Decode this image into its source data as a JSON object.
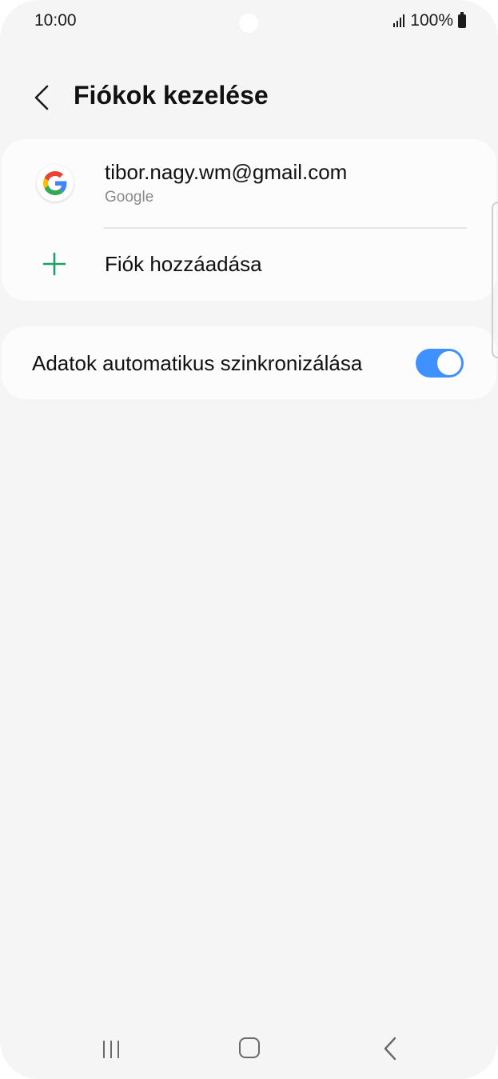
{
  "status_bar": {
    "time": "10:00",
    "battery_text": "100%",
    "signal_icon": "signal-icon",
    "battery_icon": "battery-icon"
  },
  "header": {
    "title": "Fiókok kezelése",
    "back_icon": "chevron-left-icon"
  },
  "accounts": {
    "items": [
      {
        "email": "tibor.nagy.wm@gmail.com",
        "type": "Google",
        "icon": "google-icon"
      }
    ],
    "add_label": "Fiók hozzáadása",
    "add_icon": "plus-icon"
  },
  "sync": {
    "label": "Adatok automatikus szinkronizálása",
    "enabled": true
  },
  "nav": {
    "recents_icon": "recents-icon",
    "home_icon": "home-icon",
    "back_icon": "back-icon"
  },
  "colors": {
    "background": "#f5f5f5",
    "card": "#fcfcfc",
    "toggle_on": "#3e91ff",
    "plus_green": "#1e9e6a"
  }
}
